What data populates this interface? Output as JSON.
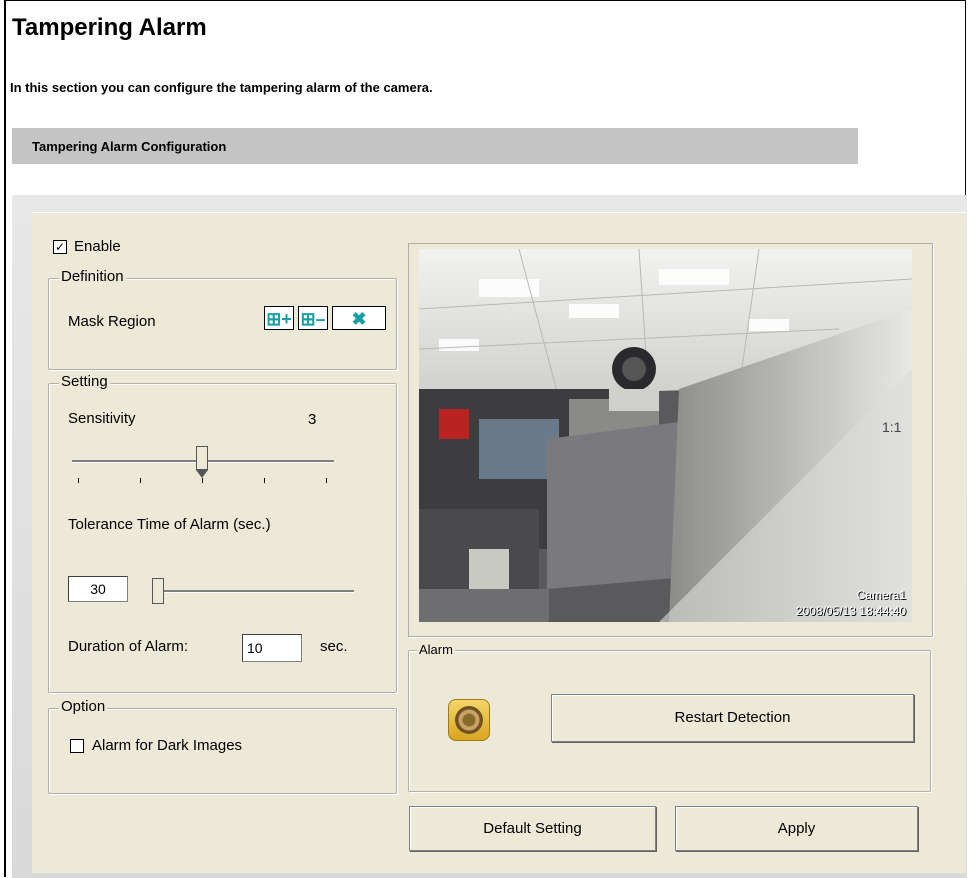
{
  "page": {
    "title": "Tampering Alarm",
    "description": "In this section you can configure the tampering alarm of the camera.",
    "section_title": "Tampering Alarm Configuration"
  },
  "enable": {
    "label": "Enable",
    "checked": true
  },
  "definition": {
    "title": "Definition",
    "mask_region_label": "Mask Region",
    "buttons": [
      {
        "icon": "add-region-icon",
        "glyph": "⊞+"
      },
      {
        "icon": "remove-region-icon",
        "glyph": "⊞–"
      },
      {
        "icon": "clear-region-icon",
        "glyph": "✖"
      }
    ]
  },
  "setting": {
    "title": "Setting",
    "sensitivity_label": "Sensitivity",
    "sensitivity_value": "3",
    "sensitivity_level": 3,
    "sensitivity_max": 5,
    "tolerance_label": "Tolerance Time of Alarm (sec.)",
    "tolerance_value": "30",
    "duration_label": "Duration of Alarm:",
    "duration_value": "10",
    "duration_unit": "sec."
  },
  "option": {
    "title": "Option",
    "dark_images_label": "Alarm for Dark Images",
    "dark_images_checked": false
  },
  "camera": {
    "name": "Camera1",
    "timestamp": "2008/05/13 18:44:40",
    "corner_label": "1:1"
  },
  "alarm": {
    "title": "Alarm",
    "restart_label": "Restart Detection"
  },
  "footer": {
    "default_label": "Default Setting",
    "apply_label": "Apply"
  }
}
